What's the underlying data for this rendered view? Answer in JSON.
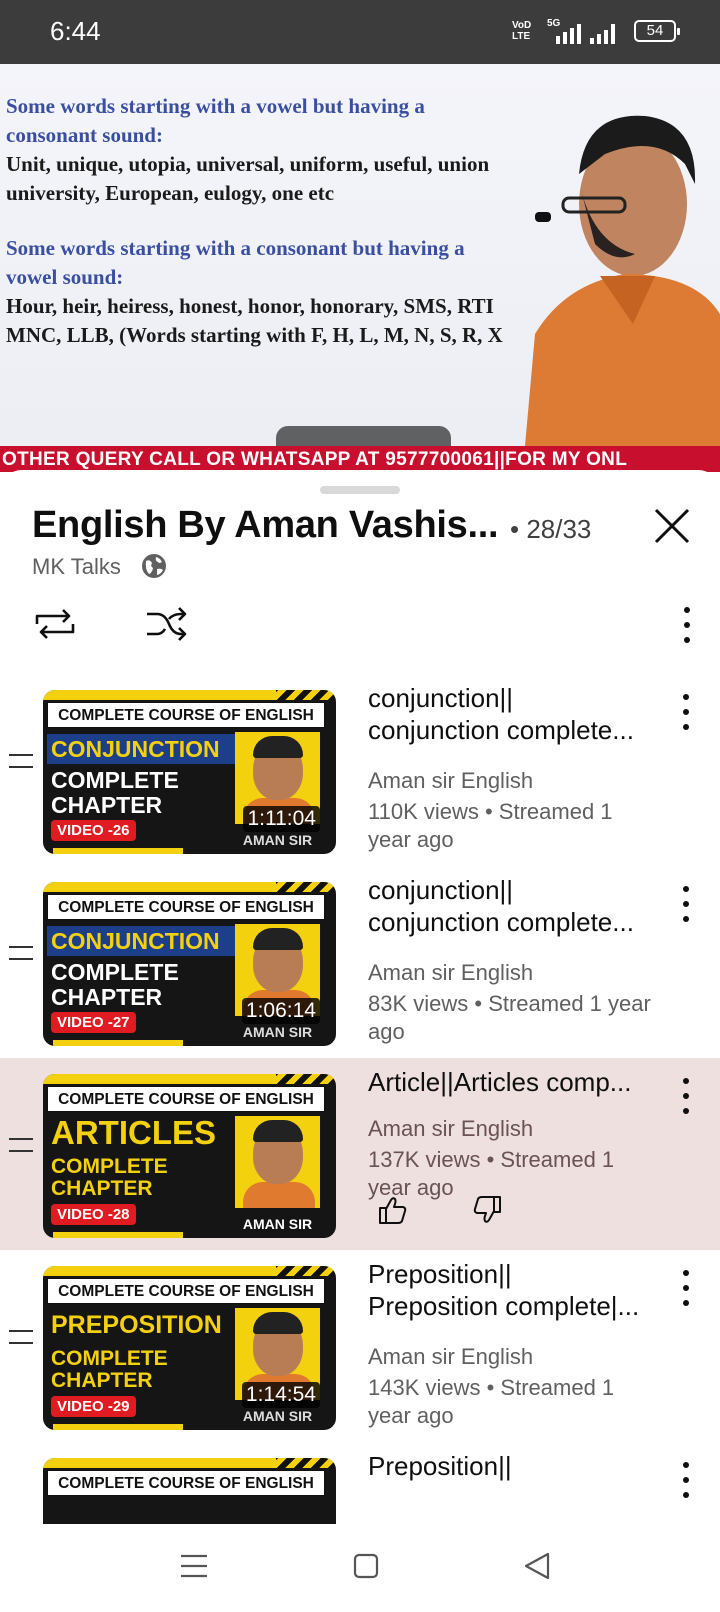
{
  "status_bar": {
    "time": "6:44",
    "network_top": "VoD",
    "network_bottom": "LTE",
    "network_type": "5G",
    "battery": "54"
  },
  "video": {
    "slide_lines": [
      {
        "text": "Some words starting with a vowel but having a",
        "color": "blue"
      },
      {
        "text": "consonant sound:",
        "color": "blue"
      },
      {
        "text": "Unit, unique, utopia, universal, uniform, useful, union",
        "color": "black"
      },
      {
        "text": "university, European,  eulogy, one etc",
        "color": "black"
      },
      {
        "text": "Some words starting with a consonant but having a",
        "color": "blue"
      },
      {
        "text": "vowel sound:",
        "color": "blue"
      },
      {
        "text": "Hour, heir, heiress, honest, honor, honorary, SMS, RTI",
        "color": "black"
      },
      {
        "text": "MNC, LLB, (Words starting with F, H, L, M, N, S, R, X",
        "color": "black"
      }
    ],
    "ticker_text": "OTHER QUERY CALL OR WHATSAPP AT 9577700061||FOR MY ONL"
  },
  "playlist": {
    "title": "English By Aman Vashis...",
    "position": "• 28/33",
    "channel": "MK Talks",
    "icons": {
      "close": "close-icon",
      "loop": "loop-icon",
      "shuffle": "shuffle-icon",
      "more": "more-vert-icon",
      "privacy": "globe-icon"
    }
  },
  "items": [
    {
      "banner": "COMPLETE COURSE OF ENGLISH",
      "topic": "CONJUNCTION",
      "sub": "COMPLETE\nCHAPTER",
      "badge": "VIDEO -26",
      "teacher": "AMAN SIR",
      "duration": "1:11:04",
      "title_line1": "conjunction||",
      "title_line2": "conjunction complete...",
      "channel": "Aman sir English",
      "meta": "110K views • Streamed 1 year ago",
      "active": false
    },
    {
      "banner": "COMPLETE COURSE OF ENGLISH",
      "topic": "CONJUNCTION",
      "sub": "COMPLETE\nCHAPTER",
      "badge": "VIDEO -27",
      "teacher": "AMAN SIR",
      "duration": "1:06:14",
      "title_line1": "conjunction||",
      "title_line2": "conjunction complete...",
      "channel": "Aman sir English",
      "meta": "83K views • Streamed 1 year ago",
      "active": false
    },
    {
      "banner": "COMPLETE COURSE OF ENGLISH",
      "topic": "ARTICLES",
      "sub": "COMPLETE\nCHAPTER",
      "badge": "VIDEO -28",
      "teacher": "AMAN SIR",
      "duration": "",
      "title_line1": "Article||Articles comp...",
      "channel": "Aman sir English",
      "meta": "137K views • Streamed 1 year ago",
      "active": true
    },
    {
      "banner": "COMPLETE COURSE OF ENGLISH",
      "topic": "PREPOSITION",
      "sub": "COMPLETE\nCHAPTER",
      "badge": "VIDEO -29",
      "teacher": "AMAN SIR",
      "duration": "1:14:54",
      "title_line1": "Preposition||",
      "title_line2": "Preposition complete|...",
      "channel": "Aman sir English",
      "meta": "143K views • Streamed 1 year ago",
      "active": false
    },
    {
      "banner": "COMPLETE COURSE OF ENGLISH",
      "title_line1": "Preposition||"
    }
  ],
  "colors": {
    "active_row": "#ede0df",
    "ticker": "#c8102e",
    "thumb_yellow": "#f4d10f",
    "badge_red": "#e11b22"
  },
  "navbar": {
    "icons": [
      "menu-icon",
      "home-square-icon",
      "back-triangle-icon"
    ]
  }
}
